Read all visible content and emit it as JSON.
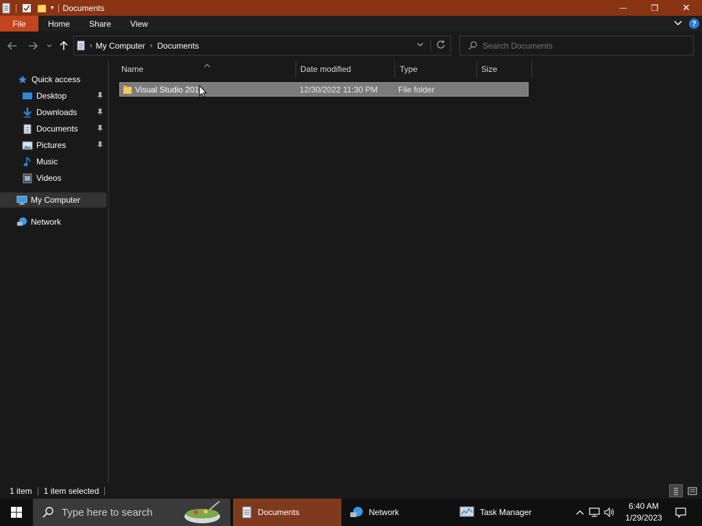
{
  "window": {
    "title": "Documents",
    "controls": {
      "minimize": "—",
      "restore": "❐",
      "close": "✕"
    }
  },
  "ribbon": {
    "tabs": [
      {
        "label": "File"
      },
      {
        "label": "Home"
      },
      {
        "label": "Share"
      },
      {
        "label": "View"
      }
    ],
    "help": "?"
  },
  "address": {
    "breadcrumb": [
      "My Computer",
      "Documents"
    ]
  },
  "search": {
    "placeholder": "Search Documents"
  },
  "nav": {
    "quick_access": "Quick access",
    "items": [
      {
        "label": "Desktop",
        "pinned": true
      },
      {
        "label": "Downloads",
        "pinned": true
      },
      {
        "label": "Documents",
        "pinned": true
      },
      {
        "label": "Pictures",
        "pinned": true
      },
      {
        "label": "Music",
        "pinned": false
      },
      {
        "label": "Videos",
        "pinned": false
      }
    ],
    "my_computer": "My Computer",
    "network": "Network"
  },
  "columns": [
    "Name",
    "Date modified",
    "Type",
    "Size"
  ],
  "files": [
    {
      "name": "Visual Studio 201",
      "date": "12/30/2022 11:30 PM",
      "type": "File folder",
      "size": ""
    }
  ],
  "status": {
    "count": "1 item",
    "selected": "1 item selected"
  },
  "taskbar": {
    "search_placeholder": "Type here to search",
    "tasks": [
      {
        "label": "Documents"
      },
      {
        "label": "Network"
      },
      {
        "label": "Task Manager"
      }
    ],
    "time": "6:40 AM",
    "date": "1/29/2023"
  },
  "colors": {
    "titlebar": "#8a3413",
    "file_tab": "#c4441b",
    "selection": "#7b7b7b",
    "active_task": "#7f3a1d"
  }
}
